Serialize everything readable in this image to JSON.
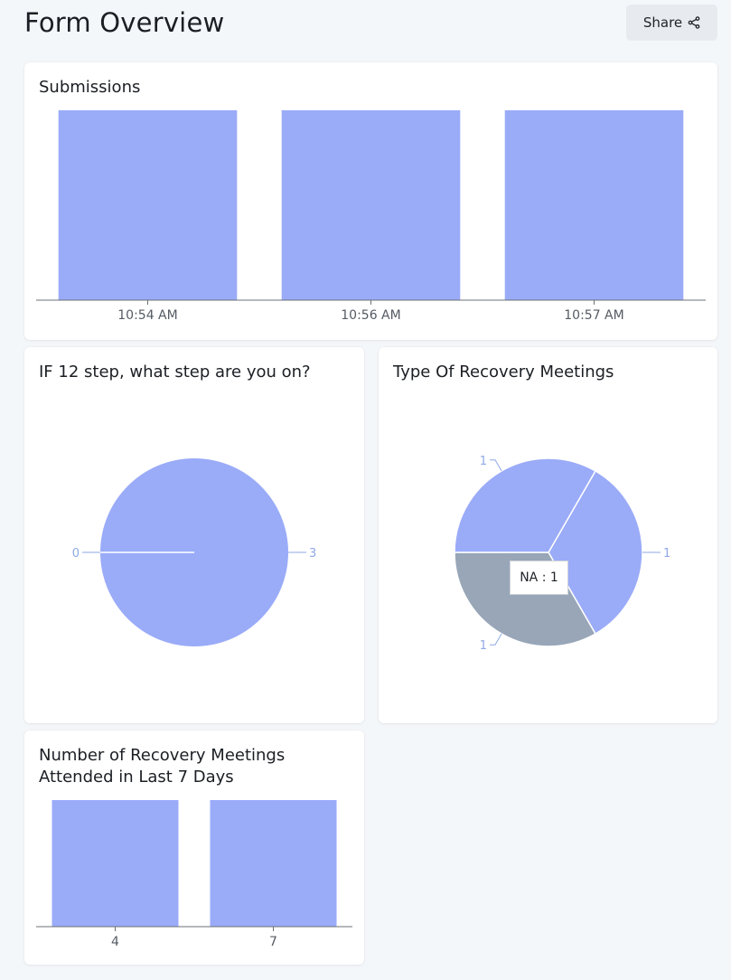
{
  "header": {
    "title": "Form Overview",
    "share_label": "Share",
    "share_icon": "share-icon"
  },
  "colors": {
    "primary_series": "#9aabf8",
    "secondary_series": "#98a6b8",
    "axis": "#6b7075",
    "pie_label": "#8fa8e6"
  },
  "chart_data": [
    {
      "id": "submissions",
      "type": "bar",
      "title": "Submissions",
      "categories": [
        "10:54 AM",
        "10:56 AM",
        "10:57 AM"
      ],
      "values": [
        1,
        1,
        1
      ],
      "ylim": [
        0,
        1
      ],
      "grid": false,
      "legend": "none"
    },
    {
      "id": "step",
      "type": "pie",
      "title": "IF 12 step, what step are you on?",
      "slices": [
        {
          "label": "3",
          "value": 3,
          "color": "#9aabf8"
        },
        {
          "label": "0",
          "value": 0,
          "color": "#9aabf8"
        }
      ],
      "legend": "none"
    },
    {
      "id": "type",
      "type": "pie",
      "title": "Type Of Recovery Meetings",
      "slices": [
        {
          "label": "1",
          "value": 1,
          "color": "#9aabf8"
        },
        {
          "label": "1",
          "value": 1,
          "color": "#98a6b8"
        },
        {
          "label": "1",
          "value": 1,
          "color": "#9aabf8"
        }
      ],
      "tooltip": "NA : 1",
      "legend": "none"
    },
    {
      "id": "meetings",
      "type": "bar",
      "title": "Number of Recovery Meetings\nAttended in Last 7 Days",
      "categories": [
        "4",
        "7"
      ],
      "values": [
        1,
        1
      ],
      "ylim": [
        0,
        1
      ],
      "grid": false,
      "legend": "none"
    }
  ]
}
